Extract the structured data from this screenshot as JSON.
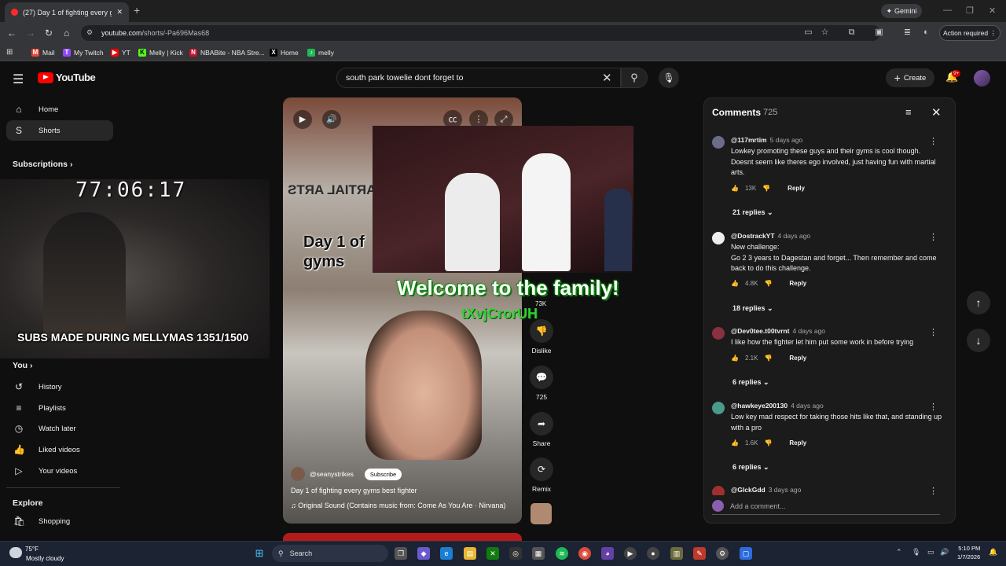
{
  "browser": {
    "tab_title": "(27) Day 1 of fighting every gy...",
    "tab_close": "✕",
    "new_tab": "+",
    "gemini": "Gemini",
    "url_domain": "youtube.com",
    "url_path": "/shorts/-Pa696Mas68",
    "action_required": "Action required",
    "bookmarks": [
      {
        "label": "Mail",
        "color": "#ea4335",
        "glyph": "M"
      },
      {
        "label": "My Twitch",
        "color": "#9146ff",
        "glyph": "T"
      },
      {
        "label": "YT",
        "color": "#ff0000",
        "glyph": "▶"
      },
      {
        "label": "Melly | Kick",
        "color": "#53fc18",
        "glyph": "K"
      },
      {
        "label": "NBABite - NBA Stre...",
        "color": "#c8102e",
        "glyph": "N"
      },
      {
        "label": "Home",
        "color": "#000000",
        "glyph": "X"
      },
      {
        "label": "melly",
        "color": "#1db954",
        "glyph": "♪"
      }
    ]
  },
  "youtube": {
    "logo": "YouTube",
    "search_query": "south park towelie dont forget to",
    "create": "Create",
    "notif_badge": "9+"
  },
  "sidebar": {
    "top": [
      {
        "label": "Home",
        "icon": "⌂",
        "name": "home"
      },
      {
        "label": "Shorts",
        "icon": "S",
        "name": "shorts"
      }
    ],
    "subscriptions": "Subscriptions",
    "you": "You",
    "you_items": [
      {
        "label": "History",
        "icon": "↺",
        "name": "history"
      },
      {
        "label": "Playlists",
        "icon": "≡",
        "name": "playlists"
      },
      {
        "label": "Watch later",
        "icon": "◷",
        "name": "watch-later"
      },
      {
        "label": "Liked videos",
        "icon": "👍",
        "name": "liked-videos"
      },
      {
        "label": "Your videos",
        "icon": "▷",
        "name": "your-videos"
      }
    ],
    "explore": "Explore",
    "explore_items": [
      {
        "label": "Shopping",
        "icon": "🛍",
        "name": "shopping"
      }
    ]
  },
  "overlay": {
    "timer": "77:06:17",
    "subs_text": "SUBS MADE DURING MELLYMAS 1351/1500"
  },
  "video": {
    "martial_sign": "MARTIAL ARTS",
    "day1_text": "Day 1 of\ngyms",
    "welcome": "Welcome to the family!",
    "code": "tXvjCrorUH",
    "channel": "@seanystrikes",
    "subscribe": "Subscribe",
    "title": "Day 1 of fighting every gyms best fighter",
    "sound": "♫ Original Sound (Contains music from: Come As You Are · Nirvana)",
    "likes": "73K",
    "actions": [
      {
        "label": "Dislike",
        "icon": "👎",
        "name": "dislike"
      },
      {
        "label": "725",
        "icon": "💬",
        "name": "comments"
      },
      {
        "label": "Share",
        "icon": "➦",
        "name": "share"
      },
      {
        "label": "Remix",
        "icon": "⟳",
        "name": "remix"
      }
    ]
  },
  "comments": {
    "title": "Comments",
    "count": "725",
    "reply_label": "Reply",
    "items": [
      {
        "user": "@117mrtim",
        "time": "5 days ago",
        "text": "Lowkey promoting these guys and their gyms is cool though. Doesnt seem like theres ego involved, just having fun with martial arts.",
        "likes": "13K",
        "replies": "21 replies",
        "avatar_color": "#6b6b8a"
      },
      {
        "user": "@DostrackYT",
        "time": "4 days ago",
        "text": "New challenge:\nGo 2 3 years to Dagestan and forget... Then remember and come back to do this challenge.",
        "likes": "4.8K",
        "replies": "18 replies",
        "avatar_color": "#eeeeee"
      },
      {
        "user": "@Dev0tee.t00tvrnt",
        "time": "4 days ago",
        "text": "I like how the fighter let him put some work in before trying",
        "likes": "2.1K",
        "replies": "6 replies",
        "avatar_color": "#8a3040"
      },
      {
        "user": "@hawkeye200130",
        "time": "4 days ago",
        "text": "Low key mad respect for taking those hits like that, and standing up with a pro",
        "likes": "1.6K",
        "replies": "6 replies",
        "avatar_color": "#4a9a8a"
      },
      {
        "user": "@GlckGdd",
        "time": "3 days ago",
        "text": "",
        "likes": "",
        "replies": "",
        "avatar_color": "#a03030"
      }
    ],
    "add_placeholder": "Add a comment..."
  },
  "taskbar": {
    "temp": "75°F",
    "weather": "Mostly cloudy",
    "search": "Search",
    "time": "5:10 PM",
    "date": "1/7/2026"
  }
}
